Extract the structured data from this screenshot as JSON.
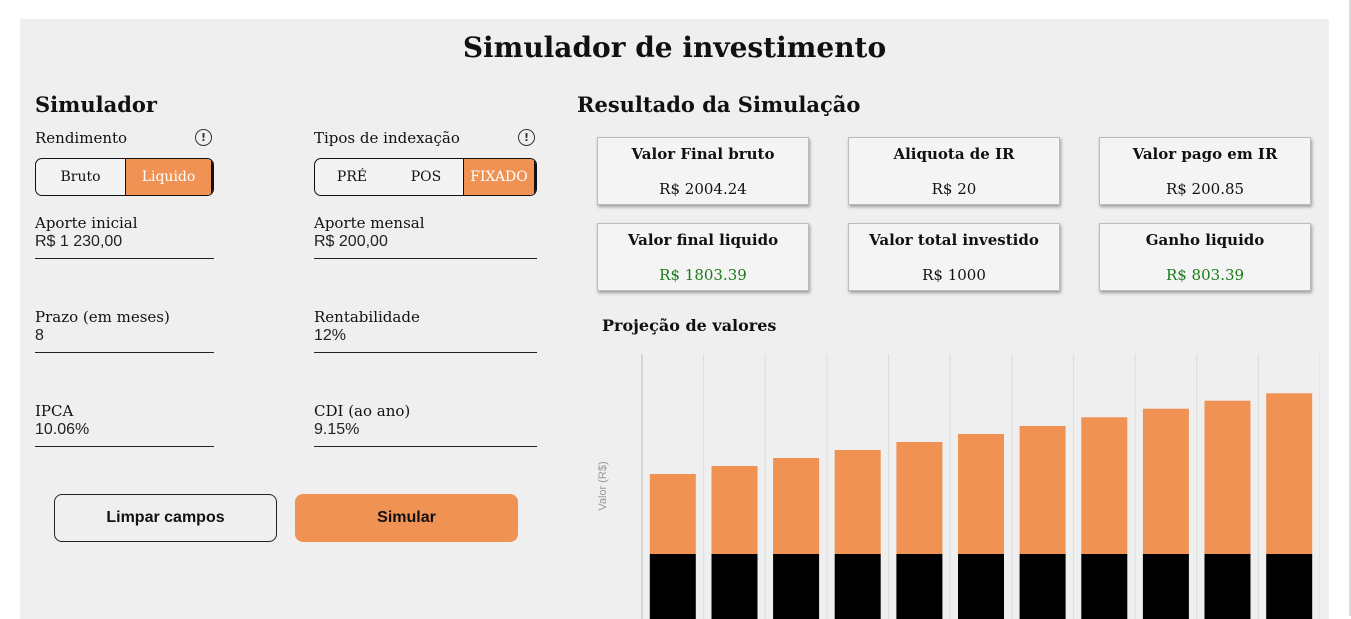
{
  "title": "Simulador de investimento",
  "simulator": {
    "heading": "Simulador",
    "rendimento": {
      "label": "Rendimento",
      "options": [
        "Bruto",
        "Liquido"
      ],
      "selected": "Liquido"
    },
    "indexacao": {
      "label": "Tipos de indexação",
      "options": [
        "PRÉ",
        "POS",
        "FIXADO"
      ],
      "selected": "FIXADO"
    },
    "fields": {
      "aporte_inicial": {
        "label": "Aporte inicial",
        "value": "R$ 1 230,00"
      },
      "aporte_mensal": {
        "label": "Aporte mensal",
        "value": "R$ 200,00"
      },
      "prazo": {
        "label": "Prazo (em meses)",
        "value": "8"
      },
      "rentabilidade": {
        "label": "Rentabilidade",
        "value": "12%"
      },
      "ipca": {
        "label": "IPCA",
        "value": "10.06%"
      },
      "cdi": {
        "label": "CDI (ao ano)",
        "value": "9.15%"
      }
    },
    "buttons": {
      "clear": "Limpar campos",
      "simulate": "Simular"
    }
  },
  "results": {
    "heading": "Resultado da Simulação",
    "cards": [
      {
        "title": "Valor Final bruto",
        "value": "R$ 2004.24",
        "highlight": false
      },
      {
        "title": "Aliquota de IR",
        "value": "R$ 20",
        "highlight": false
      },
      {
        "title": "Valor pago em IR",
        "value": "R$ 200.85",
        "highlight": false
      },
      {
        "title": "Valor final liquido",
        "value": "R$ 1803.39",
        "highlight": true
      },
      {
        "title": "Valor total investido",
        "value": "R$ 1000",
        "highlight": false
      },
      {
        "title": "Ganho liquido",
        "value": "R$ 803.39",
        "highlight": true
      }
    ]
  },
  "chart_data": {
    "type": "bar",
    "title": "Projeção de valores",
    "ylabel": "Valor (R$)",
    "stacked": true,
    "series": [
      {
        "color": "#000000",
        "values": [
          600,
          600,
          600,
          600,
          600,
          600,
          600,
          600,
          600,
          600,
          600
        ]
      },
      {
        "color": "#ef9254",
        "values": [
          600,
          660,
          720,
          780,
          840,
          900,
          960,
          1025,
          1090,
          1150,
          1205
        ]
      }
    ],
    "ymax": 2100
  },
  "colors": {
    "accent": "#ef9254",
    "background": "#efefef",
    "positive": "#1a7a1a"
  }
}
